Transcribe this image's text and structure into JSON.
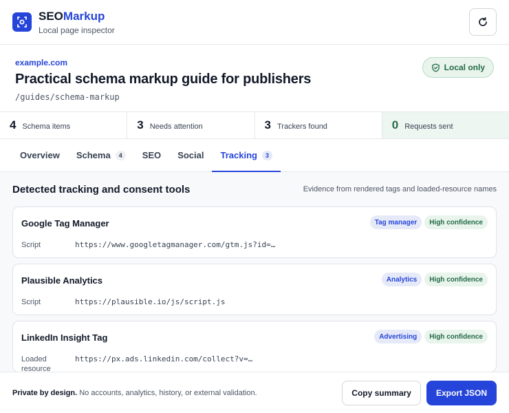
{
  "app": {
    "name_part1": "SEO",
    "name_part2": "Markup",
    "subtitle": "Local page inspector"
  },
  "page": {
    "domain": "example.com",
    "title": "Practical schema markup guide for publishers",
    "path": "/guides/schema-markup",
    "local_badge": "Local only"
  },
  "stats": [
    {
      "value": "4",
      "label": "Schema items"
    },
    {
      "value": "3",
      "label": "Needs attention"
    },
    {
      "value": "3",
      "label": "Trackers found"
    },
    {
      "value": "0",
      "label": "Requests sent"
    }
  ],
  "tabs": [
    {
      "label": "Overview",
      "count": ""
    },
    {
      "label": "Schema",
      "count": "4"
    },
    {
      "label": "SEO",
      "count": ""
    },
    {
      "label": "Social",
      "count": ""
    },
    {
      "label": "Tracking",
      "count": "3",
      "active": true
    }
  ],
  "section": {
    "title": "Detected tracking and consent tools",
    "note": "Evidence from rendered tags and loaded-resource names"
  },
  "trackers": [
    {
      "name": "Google Tag Manager",
      "category": "Tag manager",
      "confidence": "High confidence",
      "evidence_label": "Script",
      "evidence_value": "https://www.googletagmanager.com/gtm.js?id=…"
    },
    {
      "name": "Plausible Analytics",
      "category": "Analytics",
      "confidence": "High confidence",
      "evidence_label": "Script",
      "evidence_value": "https://plausible.io/js/script.js"
    },
    {
      "name": "LinkedIn Insight Tag",
      "category": "Advertising",
      "confidence": "High confidence",
      "evidence_label": "Loaded resource",
      "evidence_value": "https://px.ads.linkedin.com/collect?v=…"
    }
  ],
  "footer": {
    "privacy_bold": "Private by design.",
    "privacy_text": "No accounts, analytics, history, or external validation.",
    "copy_label": "Copy summary",
    "export_label": "Export JSON"
  },
  "colors": {
    "accent": "#2544d9",
    "success": "#246b45",
    "success_bg": "#e8f4ec"
  }
}
